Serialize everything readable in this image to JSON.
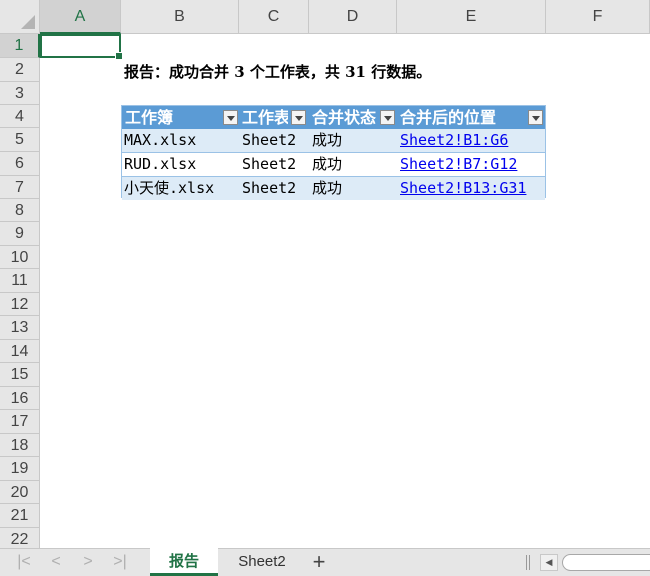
{
  "columns": [
    "A",
    "B",
    "C",
    "D",
    "E",
    "F"
  ],
  "rows": [
    "1",
    "2",
    "3",
    "4",
    "5",
    "6",
    "7",
    "8",
    "9",
    "10",
    "11",
    "12",
    "13",
    "14",
    "15",
    "16",
    "17",
    "18",
    "19",
    "20",
    "21",
    "22"
  ],
  "report_text": "报告：成功合并 3 个工作表，共 31 行数据。",
  "table": {
    "headers": [
      "工作簿",
      "工作表",
      "合并状态",
      "合并后的位置"
    ],
    "rows": [
      [
        "MAX.xlsx",
        "Sheet2",
        "成功",
        "Sheet2!B1:G6"
      ],
      [
        "RUD.xlsx",
        "Sheet2",
        "成功",
        "Sheet2!B7:G12"
      ],
      [
        "小天使.xlsx",
        "Sheet2",
        "成功",
        "Sheet2!B13:G31"
      ]
    ]
  },
  "tabs": [
    "报告",
    "Sheet2"
  ],
  "nav": {
    "first": "|<",
    "prev": "<",
    "next": ">",
    "last": ">|",
    "add": "+"
  },
  "colors": {
    "accent": "#217346",
    "table_header": "#5b9bd5",
    "table_band": "#ddebf7"
  }
}
